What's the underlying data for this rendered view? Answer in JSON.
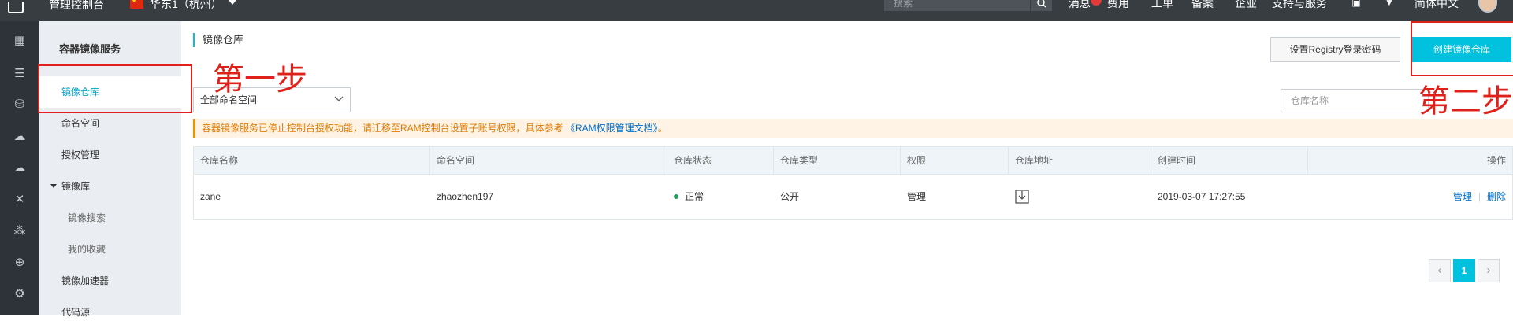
{
  "topbar": {
    "title": "管理控制台",
    "region": "华东1（杭州）",
    "search_placeholder": "搜索",
    "nav": [
      "消息",
      "费用",
      "工单",
      "备案",
      "企业",
      "支持与服务"
    ],
    "language": "简体中文"
  },
  "sidebar": {
    "title": "容器镜像服务",
    "items": [
      {
        "label": "镜像仓库",
        "active": true
      },
      {
        "label": "命名空间"
      },
      {
        "label": "授权管理"
      },
      {
        "label": "镜像库",
        "group": true
      },
      {
        "label": "镜像搜索",
        "sub": true
      },
      {
        "label": "我的收藏",
        "sub": true
      },
      {
        "label": "镜像加速器"
      },
      {
        "label": "代码源"
      }
    ]
  },
  "main": {
    "page_title": "镜像仓库",
    "registry_password_button": "设置Registry登录密码",
    "create_repo_button": "创建镜像仓库",
    "namespace_select": "全部命名空间",
    "repo_search_placeholder": "仓库名称",
    "notice_text": "容器镜像服务已停止控制台授权功能，请迁移至RAM控制台设置子账号权限，具体参考",
    "notice_link": "《RAM权限管理文档》",
    "notice_end": "。",
    "table": {
      "headers": [
        "仓库名称",
        "命名空间",
        "仓库状态",
        "仓库类型",
        "权限",
        "仓库地址",
        "创建时间",
        "操作"
      ],
      "rows": [
        {
          "name": "zane",
          "namespace": "zhaozhen197",
          "status": "正常",
          "type": "公开",
          "permission": "管理",
          "created": "2019-03-07 17:27:55",
          "actions": [
            "管理",
            "删除"
          ]
        }
      ]
    },
    "pagination": {
      "prev": "‹",
      "current": "1",
      "next": "›"
    }
  },
  "annotations": {
    "step1": "第一步",
    "step2": "第二步"
  },
  "colors": {
    "accent": "#00c1de",
    "annotation": "#e0201a",
    "topbar": "#373d41",
    "link": "#0070cc",
    "status_ok": "#1e9e5d"
  }
}
